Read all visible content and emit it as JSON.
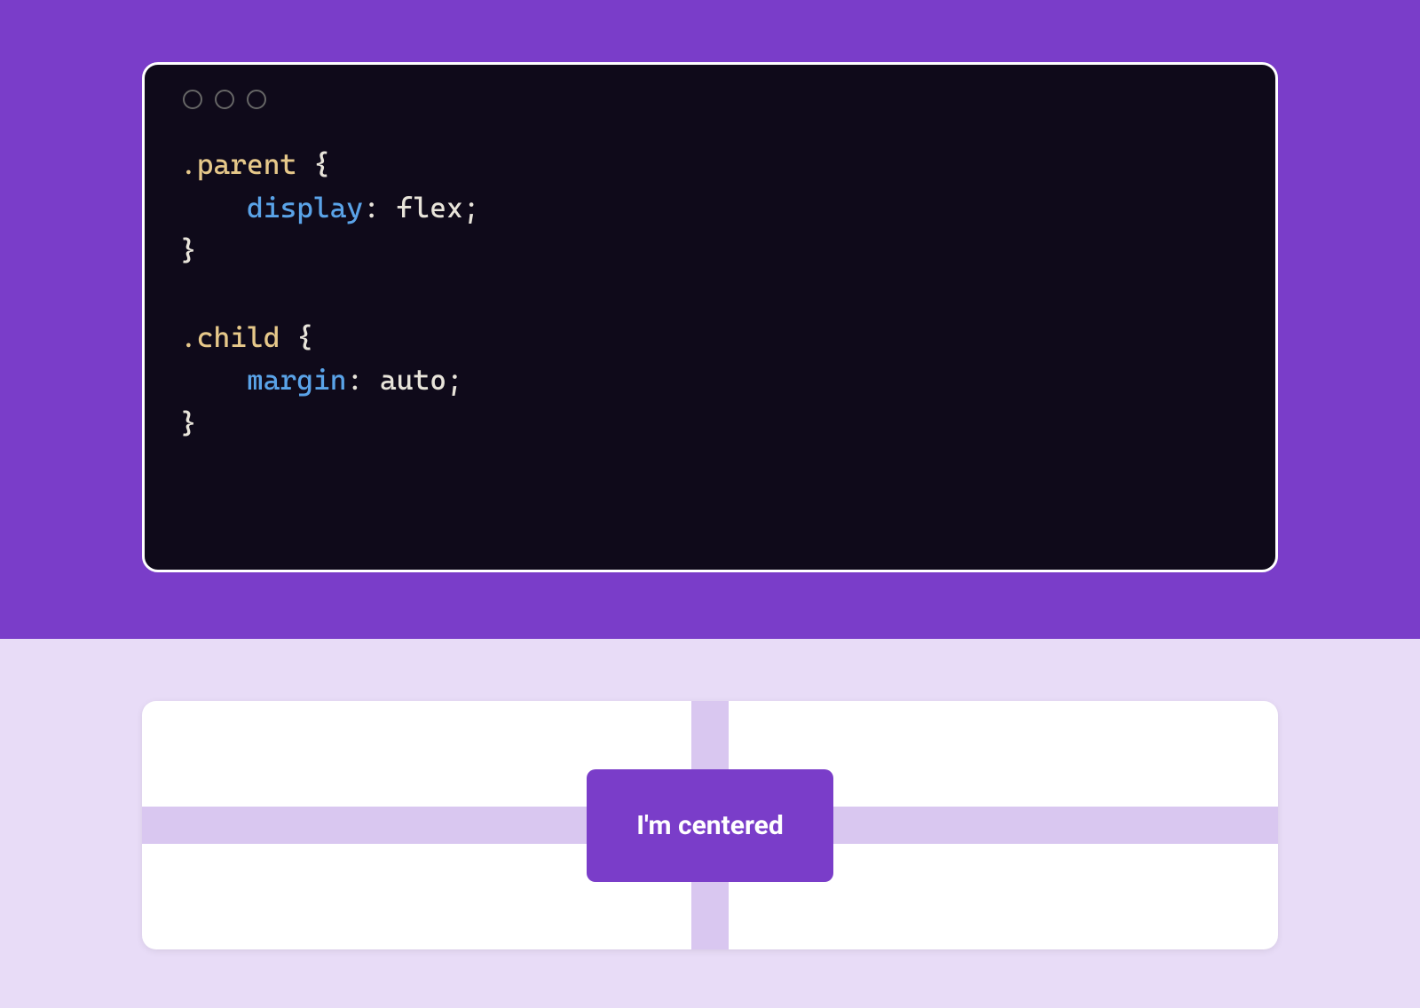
{
  "code": {
    "rules": [
      {
        "selector": ".parent",
        "declarations": [
          {
            "property": "display",
            "value": "flex"
          }
        ]
      },
      {
        "selector": ".child",
        "declarations": [
          {
            "property": "margin",
            "value": "auto"
          }
        ]
      }
    ]
  },
  "demo": {
    "centered_label": "I'm centered"
  },
  "colors": {
    "accent": "#7a3dc9",
    "code_bg": "#0f0a1a",
    "page_bg_light": "#e8dcf7",
    "guide": "#d9c7f0",
    "selector": "#e6c88a",
    "property": "#5aa3e8"
  }
}
